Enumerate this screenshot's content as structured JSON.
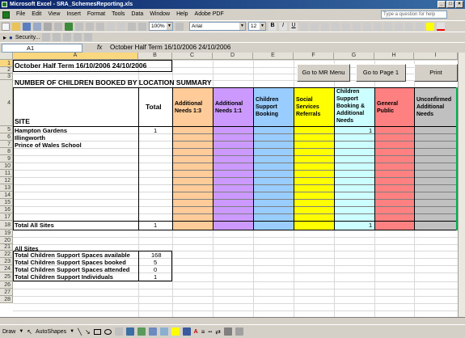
{
  "window": {
    "title": "Microsoft Excel - SRA_SchemesReporting.xls"
  },
  "menu": [
    "File",
    "Edit",
    "View",
    "Insert",
    "Format",
    "Tools",
    "Data",
    "Window",
    "Help",
    "Adobe PDF"
  ],
  "help_placeholder": "Type a question for help",
  "toolbar": {
    "zoom": "100%",
    "font": "Arial",
    "size": "12",
    "security_label": "Security..."
  },
  "formula_bar": {
    "cell_ref": "A1",
    "fx": "fx",
    "content": "October Half Term  16/10/2006  24/10/2006"
  },
  "columns": [
    "A",
    "B",
    "C",
    "D",
    "E",
    "F",
    "G",
    "H",
    "I"
  ],
  "rows": [
    "1",
    "2",
    "3",
    "4",
    "5",
    "6",
    "7",
    "8",
    "9",
    "10",
    "11",
    "12",
    "13",
    "14",
    "15",
    "16",
    "17",
    "18",
    "19",
    "20",
    "21",
    "22",
    "23",
    "24",
    "25",
    "26",
    "27",
    "28"
  ],
  "sheet": {
    "a1": "October Half Term  16/10/2006  24/10/2006",
    "a3": "NUMBER OF CHILDREN BOOKED BY LOCATION SUMMARY",
    "site_header": "SITE",
    "total_header": "Total",
    "category_headers": [
      "Additional Needs 1:3",
      "Additional Needs 1:1",
      "Children Support Booking",
      "Social Services Referrals",
      "Children Support Booking & Additional Needs",
      "General Public",
      "Unconfirmed Additional Needs"
    ],
    "sites": [
      "Hampton Gardens",
      "Illingworth",
      "Prince of Wales School"
    ],
    "hampton_total": "1",
    "hampton_g": "1",
    "total_all_sites_label": "Total All Sites",
    "total_all_sites": "1",
    "total_all_sites_g": "1",
    "summary_title": "All Sites",
    "summary_rows": [
      {
        "label": "Total Children Support Spaces available",
        "value": "168"
      },
      {
        "label": "Total Children Support Spaces booked",
        "value": "5"
      },
      {
        "label": "Total Children Support Spaces attended",
        "value": "0"
      },
      {
        "label": "Total Children Support Individuals",
        "value": "1"
      }
    ]
  },
  "buttons": {
    "mr_menu": "Go to MR Menu",
    "page1": "Go to Page 1",
    "print": "Print"
  },
  "drawbar": {
    "draw": "Draw",
    "autoshapes": "AutoShapes"
  },
  "colors": {
    "c": "#ffcc99",
    "d": "#cc99ff",
    "e": "#99ccff",
    "f": "#ffff00",
    "g": "#ccffff",
    "h": "#ff8080",
    "i": "#c0c0c0",
    "row_highlight": "#00b050"
  }
}
